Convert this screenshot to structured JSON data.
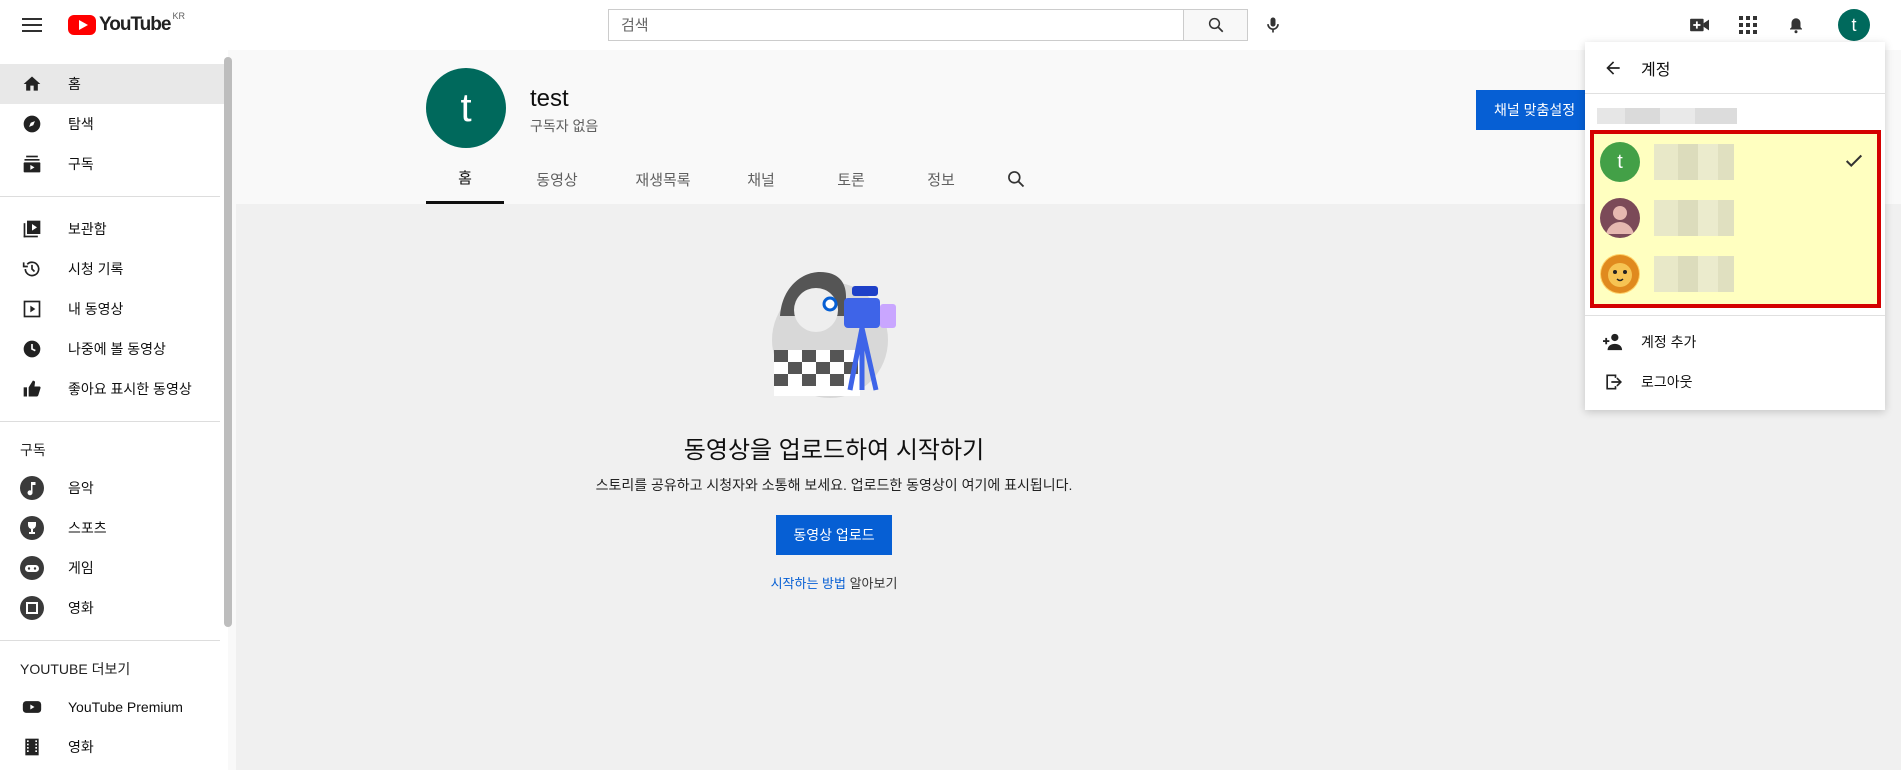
{
  "header": {
    "logo_text": "YouTube",
    "logo_region": "KR",
    "search_placeholder": "검색"
  },
  "sidebar": {
    "main_items": [
      {
        "label": "홈",
        "icon": "home-icon",
        "active": true
      },
      {
        "label": "탐색",
        "icon": "compass-icon"
      },
      {
        "label": "구독",
        "icon": "subscriptions-icon"
      }
    ],
    "library_items": [
      {
        "label": "보관함",
        "icon": "library-icon"
      },
      {
        "label": "시청 기록",
        "icon": "history-icon"
      },
      {
        "label": "내 동영상",
        "icon": "my-videos-icon"
      },
      {
        "label": "나중에 볼 동영상",
        "icon": "watch-later-icon"
      },
      {
        "label": "좋아요 표시한 동영상",
        "icon": "thumbs-up-icon"
      }
    ],
    "subscriptions_heading": "구독",
    "subscriptions": [
      {
        "label": "음악",
        "icon": "music-channel-icon"
      },
      {
        "label": "스포츠",
        "icon": "sports-channel-icon"
      },
      {
        "label": "게임",
        "icon": "gaming-channel-icon"
      },
      {
        "label": "영화",
        "icon": "movies-channel-icon"
      }
    ],
    "more_heading_brand": "YOUTUBE",
    "more_heading_rest": "더보기",
    "more_items": [
      {
        "label": "YouTube Premium",
        "icon": "youtube-icon"
      },
      {
        "label": "영화",
        "icon": "film-icon"
      }
    ]
  },
  "channel": {
    "avatar_letter": "t",
    "name": "test",
    "subscribers": "구독자 없음",
    "customize_button": "채널 맞춤설정",
    "tabs": [
      "홈",
      "동영상",
      "재생목록",
      "채널",
      "토론",
      "정보"
    ]
  },
  "empty_state": {
    "title": "동영상을 업로드하여 시작하기",
    "description": "스토리를 공유하고 시청자와 소통해 보세요. 업로드한 동영상이 여기에 표시됩니다.",
    "upload_button": "동영상 업로드",
    "learn_link": "시작하는 방법",
    "learn_rest": " 알아보기"
  },
  "account_panel": {
    "title": "계정",
    "accounts": [
      {
        "avatar_letter": "t",
        "avatar_color": "#43a047",
        "selected": true
      },
      {
        "avatar_letter": "",
        "avatar_color": "#7b4a58",
        "selected": false
      },
      {
        "avatar_letter": "",
        "avatar_color": "#f2a93b",
        "selected": false
      }
    ],
    "add_account": "계정 추가",
    "logout": "로그아웃"
  },
  "colors": {
    "brand_red": "#ff0000",
    "primary_blue": "#065fd4",
    "avatar_teal": "#00695c",
    "highlight_border": "#d40000",
    "highlight_fill": "#ffffc0"
  }
}
